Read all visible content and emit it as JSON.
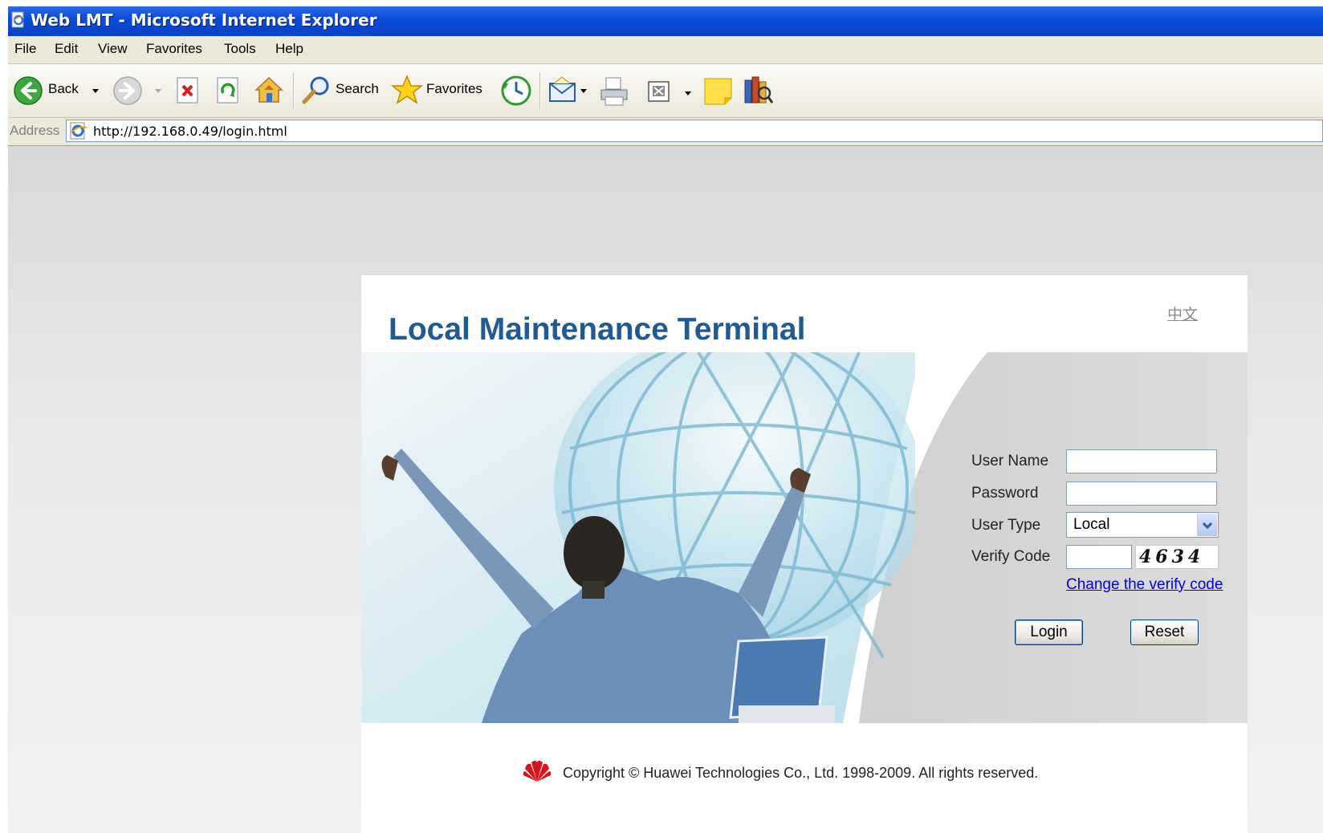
{
  "window": {
    "title": "Web LMT - Microsoft Internet Explorer"
  },
  "menu": [
    "File",
    "Edit",
    "View",
    "Favorites",
    "Tools",
    "Help"
  ],
  "toolbar": {
    "back_label": "Back",
    "search_label": "Search",
    "favorites_label": "Favorites"
  },
  "address": {
    "label": "Address",
    "url": "http://192.168.0.49/login.html"
  },
  "page": {
    "title": "Local Maintenance Terminal",
    "language_link": "中文",
    "form": {
      "username_label": "User Name",
      "username_value": "",
      "password_label": "Password",
      "password_value": "",
      "usertype_label": "User Type",
      "usertype_value": "Local",
      "verify_label": "Verify Code",
      "verify_value": "",
      "verify_image_text": "4634",
      "change_verify_link": "Change the verify code",
      "login_button": "Login",
      "reset_button": "Reset"
    },
    "footer": {
      "copyright": "Copyright © Huawei Technologies Co., Ltd. 1998-2009. All rights reserved."
    }
  },
  "colors": {
    "title_bar": "#0a4cd8",
    "heading": "#1f5a92",
    "link": "#0000ee"
  }
}
